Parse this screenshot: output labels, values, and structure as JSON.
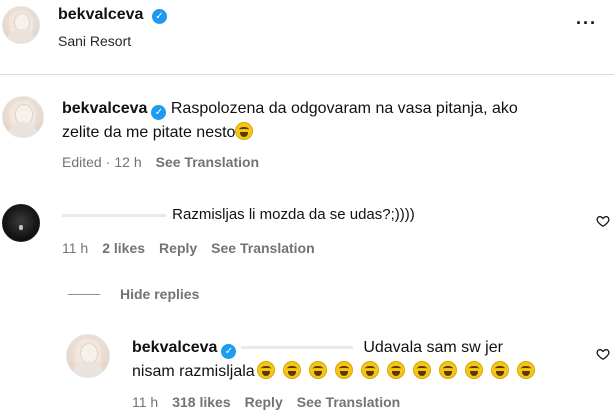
{
  "header": {
    "username": "bekvalceva",
    "location": "Sani Resort",
    "more_icon": "more-horizontal-icon"
  },
  "caption": {
    "username": "bekvalceva",
    "text_line1": "Raspolozena da odgovaram na vasa pitanja, ako",
    "text_line2": "zelite da me pitate nesto",
    "edited": "Edited",
    "time": "12 h",
    "see_translation": "See Translation"
  },
  "comment": {
    "text": "Razmisljas li mozda da se udas?;))))",
    "time": "11 h",
    "likes": "2 likes",
    "reply": "Reply",
    "see_translation": "See Translation"
  },
  "hide_replies": "Hide replies",
  "reply": {
    "username": "bekvalceva",
    "text_line1": "Udavala sam sw jer",
    "text_line2": "nisam razmisljala",
    "emoji_count": 11,
    "time": "11 h",
    "likes": "318 likes",
    "reply": "Reply",
    "see_translation": "See Translation"
  }
}
